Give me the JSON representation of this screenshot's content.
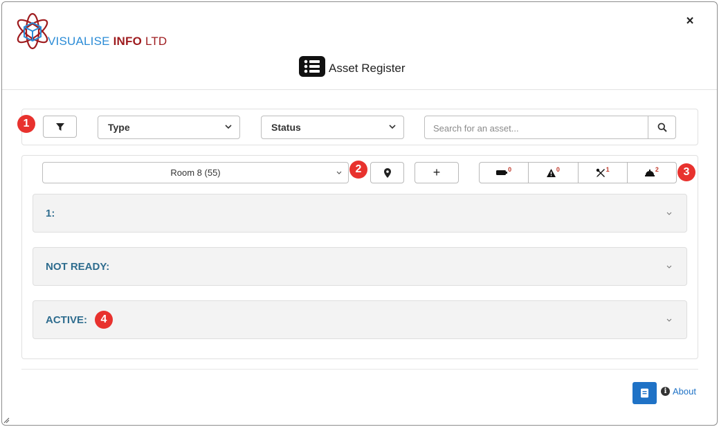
{
  "brand": {
    "part1": "VISUALISE ",
    "part2": "INFO",
    "part3": " LTD"
  },
  "header": {
    "title": "Asset Register",
    "close_label": "×"
  },
  "filters": {
    "type_label": "Type",
    "status_label": "Status",
    "search_placeholder": "Search for an asset..."
  },
  "room": {
    "selected": "Room 8 (55)"
  },
  "actions": {
    "add_label": "+"
  },
  "counters": [
    {
      "icon": "battery-icon",
      "count": "0"
    },
    {
      "icon": "warning-icon",
      "count": "0"
    },
    {
      "icon": "tools-icon",
      "count": "1"
    },
    {
      "icon": "bell-icon",
      "count": "2"
    }
  ],
  "sections": [
    {
      "label": "1:"
    },
    {
      "label": "NOT READY:"
    },
    {
      "label": "ACTIVE:"
    }
  ],
  "callouts": [
    "1",
    "2",
    "3",
    "4"
  ],
  "footer": {
    "about_label": "About",
    "info_glyph": "i"
  },
  "colors": {
    "accent": "#1f72c6",
    "section_text": "#2e6c8e",
    "callout": "#e8322e",
    "brand_blue": "#2a8bd6",
    "brand_red": "#9e1b1e"
  }
}
